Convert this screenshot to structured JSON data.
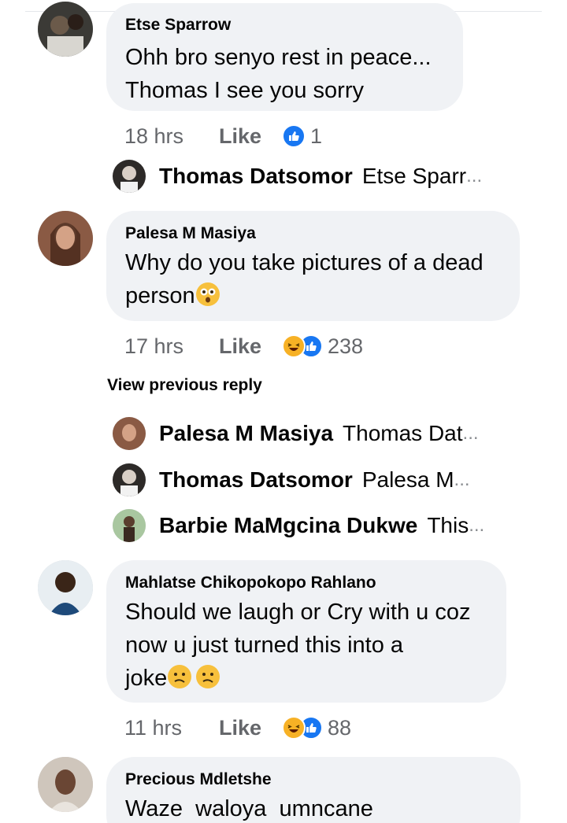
{
  "comments": [
    {
      "author": "Etse Sparrow",
      "text_lines": [
        "Ohh bro senyo rest in peace...",
        "Thomas I see you sorry"
      ],
      "time": "18 hrs",
      "like_label": "Like",
      "reaction_count": "1",
      "reactions": [
        "like-icon"
      ],
      "replies": [
        {
          "author": "Thomas Datsomor",
          "preview": "Etse Sparr",
          "ellipsis": "..."
        }
      ]
    },
    {
      "author": "Palesa M Masiya",
      "text_lines": [
        "Why do you take pictures of a dead",
        "person"
      ],
      "time": "17 hrs",
      "like_label": "Like",
      "reaction_count": "238",
      "reactions": [
        "haha-icon",
        "like-icon"
      ],
      "view_previous": "View previous reply",
      "replies": [
        {
          "author": "Palesa M Masiya",
          "preview": "Thomas Dat",
          "ellipsis": "..."
        },
        {
          "author": "Thomas Datsomor",
          "preview": "Palesa M ",
          "ellipsis": "..."
        },
        {
          "author": "Barbie MaMgcina Dukwe",
          "preview": "This",
          "ellipsis": "..."
        }
      ]
    },
    {
      "author": "Mahlatse Chikopokopo Rahlano",
      "text_lines": [
        "Should we laugh or Cry with u coz",
        "now u just turned this into a",
        "joke"
      ],
      "time": "11 hrs",
      "like_label": "Like",
      "reaction_count": "88",
      "reactions": [
        "haha-icon",
        "like-icon"
      ]
    },
    {
      "author": "Precious Mdletshe",
      "text_lines": [
        "Waze  waloya  umncane"
      ]
    }
  ],
  "colors": {
    "bubble": "#f0f2f5",
    "meta_text": "#65676b",
    "like_blue": "#1877f2",
    "haha_yellow": "#f7b125"
  }
}
